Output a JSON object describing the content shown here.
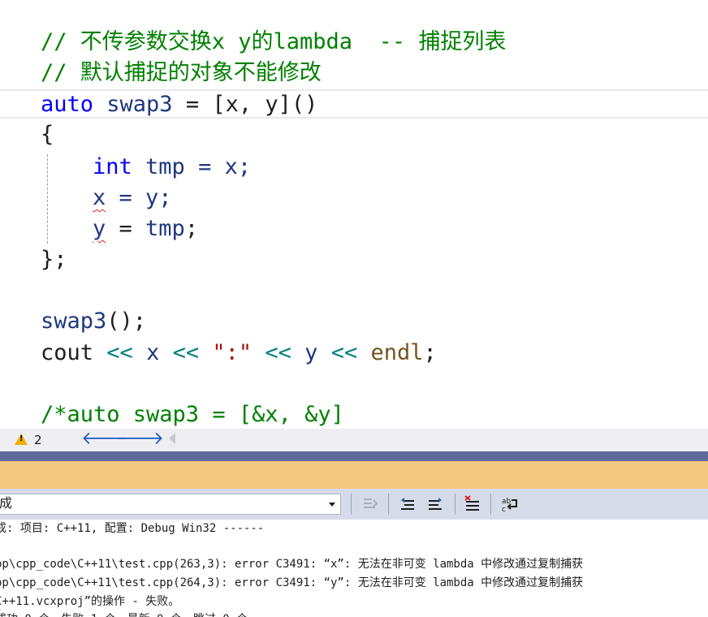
{
  "editor": {
    "lines": {
      "l1": "// 不传参数交换x y的lambda  -- 捕捉列表",
      "l2": "// 默认捕捉的对象不能修改",
      "l3_auto": "auto",
      "l3_name": " swap3",
      "l3_eq": " = ",
      "l3_cap": "[x, y]()",
      "l4": "{",
      "l5_int": "int",
      "l5_tmp": " tmp",
      "l5_rest": " = x;",
      "l6_x": "x",
      "l6_rest": " = y;",
      "l7_y": "y",
      "l7_eq": " = ",
      "l7_tmp": "tmp",
      "l7_semi": ";",
      "l8": "};",
      "l10_fn": "swap3",
      "l10_rest": "();",
      "l11_cout": "cout",
      "l11_op1": " << ",
      "l11_x": "x",
      "l11_op2": " << ",
      "l11_str": "\":\"",
      "l11_op3": " << ",
      "l11_y": "y",
      "l11_op4": " << ",
      "l11_endl": "endl",
      "l11_semi": ";",
      "l13": "/*auto swap3 = [&x, &y]"
    }
  },
  "status_bar": {
    "warning_count": "2",
    "back_icon": "arrow-left-icon",
    "forward_icon": "arrow-right-icon"
  },
  "output_toolbar": {
    "source_selected": "成"
  },
  "output": {
    "lines": [
      "成: 项目: C++11, 配置: Debug Win32 ------",
      "",
      "pp\\cpp_code\\C++11\\test.cpp(263,3): error C3491: “x”: 无法在非可变 lambda 中修改通过复制捕获",
      "pp\\cpp_code\\C++11\\test.cpp(264,3): error C3491: “y”: 无法在非可变 lambda 中修改通过复制捕获",
      "C++11.vcxproj”的操作 - 失败。",
      "成功 0 个，失败 1 个，最新 0 个，跳过 0 个"
    ]
  },
  "colors": {
    "comment": "#008000",
    "keyword": "#0000ff",
    "string": "#a31515",
    "function": "#74531f",
    "variable": "#1f377f",
    "splitter": "#5d6b99",
    "output_header": "#f5c882"
  }
}
